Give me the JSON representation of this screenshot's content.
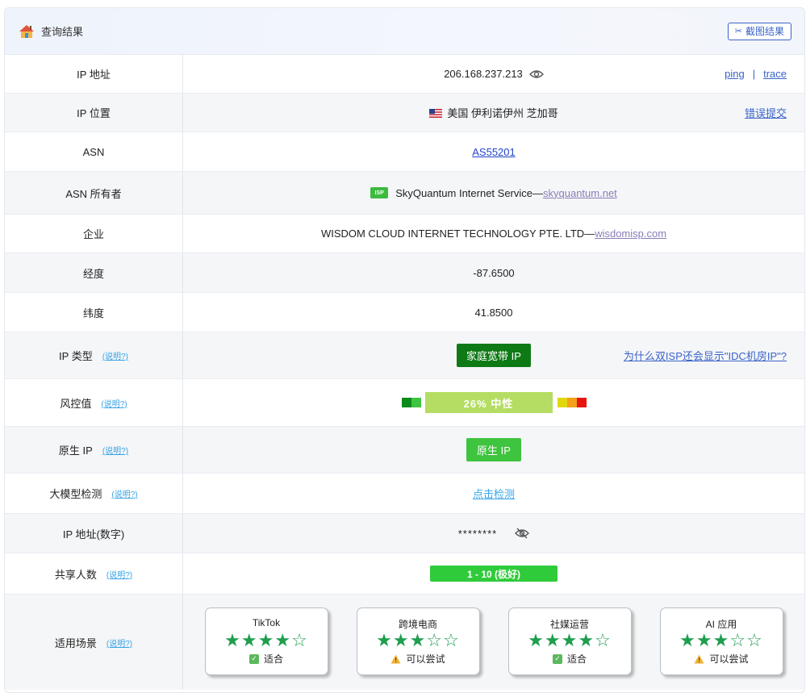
{
  "header": {
    "title": "查询结果",
    "screenshot_button": "截图结果"
  },
  "rows": {
    "ip": {
      "label": "IP 地址",
      "value": "206.168.237.213",
      "ping": "ping",
      "sep": "|",
      "trace": "trace"
    },
    "location": {
      "label": "IP 位置",
      "flag": "🇺🇸",
      "value": "美国 伊利诺伊州 芝加哥",
      "report": "错误提交"
    },
    "asn": {
      "label": "ASN",
      "value": "AS55201"
    },
    "asn_owner": {
      "label": "ASN 所有者",
      "badge": "ISP",
      "name": "SkyQuantum Internet Service—",
      "domain": "skyquantum.net"
    },
    "company": {
      "label": "企业",
      "name": "WISDOM CLOUD INTERNET TECHNOLOGY PTE. LTD—",
      "domain": "wisdomisp.com"
    },
    "longitude": {
      "label": "经度",
      "value": "-87.6500"
    },
    "latitude": {
      "label": "纬度",
      "value": "41.8500"
    },
    "ip_type": {
      "label": "IP 类型",
      "explain": "(说明?)",
      "value": "家庭宽带 IP",
      "question": "为什么双ISP还会显示\"IDC机房IP\"?"
    },
    "risk": {
      "label": "风控值",
      "explain": "(说明?)",
      "value": "26%  中性",
      "percent": 26
    },
    "native": {
      "label": "原生 IP",
      "explain": "(说明?)",
      "value": "原生 IP"
    },
    "llm": {
      "label": "大模型检测",
      "explain": "(说明?)",
      "value": "点击检测"
    },
    "ip_numeric": {
      "label": "IP 地址(数字)",
      "value": "********"
    },
    "shared": {
      "label": "共享人数",
      "explain": "(说明?)",
      "value": "1 - 10 (极好)"
    },
    "scenes": {
      "label": "适用场景",
      "explain": "(说明?)"
    }
  },
  "scenes": [
    {
      "name": "TikTok",
      "stars": 4,
      "status": "适合",
      "status_type": "ok"
    },
    {
      "name": "跨境电商",
      "stars": 3,
      "status": "可以尝试",
      "status_type": "warn"
    },
    {
      "name": "社媒运营",
      "stars": 4,
      "status": "适合",
      "status_type": "ok"
    },
    {
      "name": "AI 应用",
      "stars": 3,
      "status": "可以尝试",
      "status_type": "warn"
    }
  ],
  "colors": {
    "accent": "#3a63c8",
    "type_badge": "#0e7a16",
    "native_badge": "#3ec43e",
    "risk_bar": "#b5dd63",
    "share_bar": "#2fcb3a",
    "star": "#1e9e4e"
  },
  "icons": {
    "header": "home-icon",
    "screenshot": "scissors-icon",
    "ip_eye": "eye-icon",
    "numeric_eye": "eye-slash-icon",
    "ok": "check-icon",
    "warn": "warning-icon"
  }
}
